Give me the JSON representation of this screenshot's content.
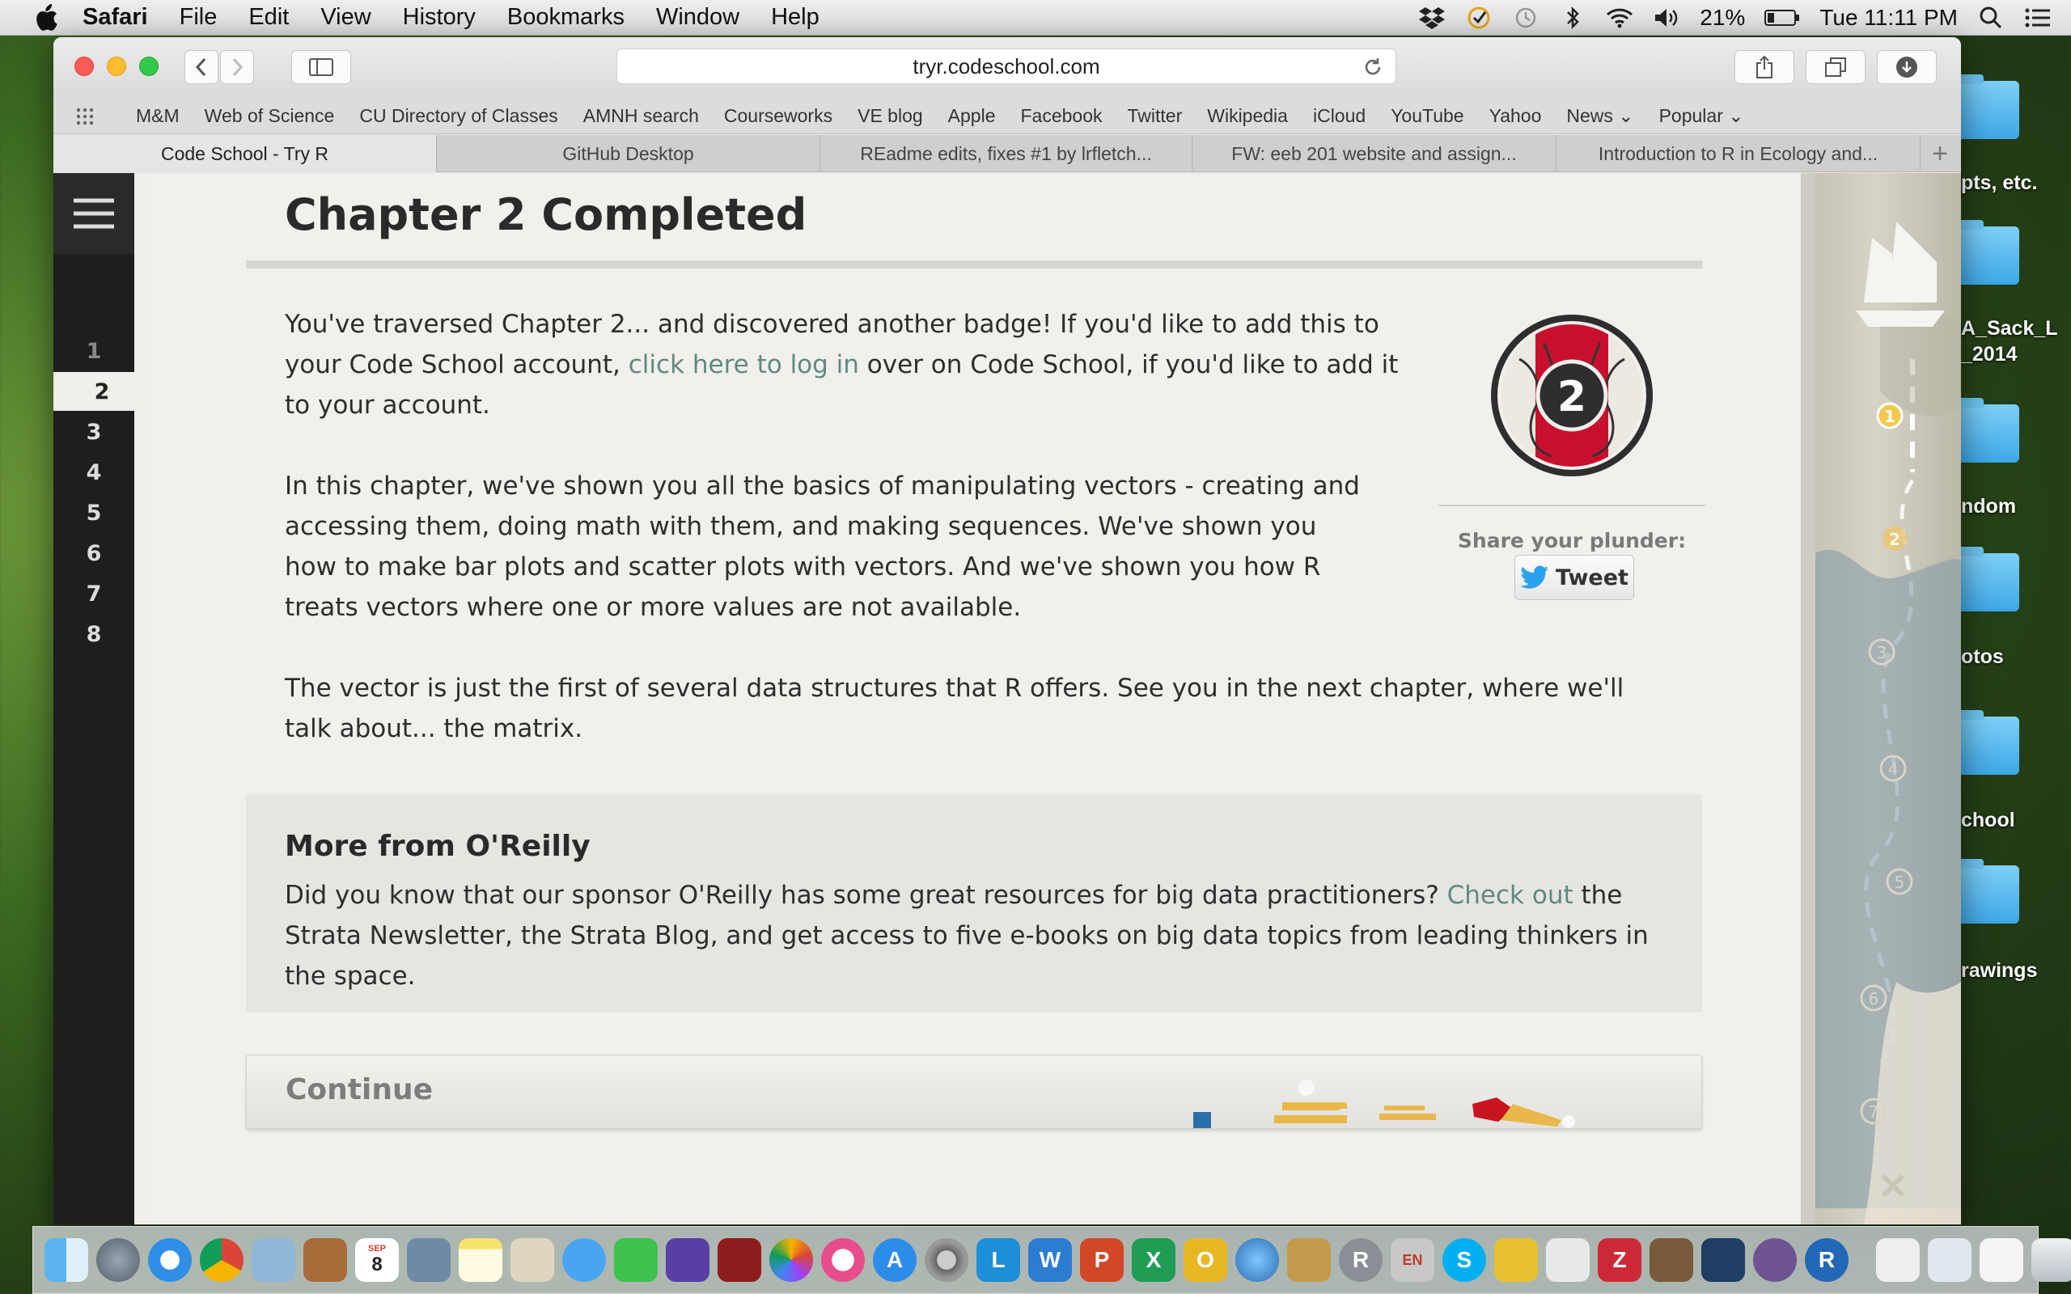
{
  "menubar": {
    "app": "Safari",
    "items": [
      "File",
      "Edit",
      "View",
      "History",
      "Bookmarks",
      "Window",
      "Help"
    ],
    "battery": "21%",
    "clock": "Tue 11:11 PM"
  },
  "browser": {
    "url": "tryr.codeschool.com",
    "favorites": [
      "M&M",
      "Web of Science",
      "CU Directory of Classes",
      "AMNH search",
      "Courseworks",
      "VE blog",
      "Apple",
      "Facebook",
      "Twitter",
      "Wikipedia",
      "iCloud",
      "YouTube",
      "Yahoo",
      "News ⌄",
      "Popular ⌄"
    ],
    "tabs": [
      {
        "title": "Code School - Try R",
        "active": true
      },
      {
        "title": "GitHub Desktop",
        "active": false
      },
      {
        "title": "REadme edits, fixes #1 by lrfletch...",
        "active": false
      },
      {
        "title": "FW: eeb 201 website and assign...",
        "active": false
      },
      {
        "title": "Introduction to R in Ecology and...",
        "active": false
      }
    ]
  },
  "nav": {
    "chapters": [
      "1",
      "2",
      "3",
      "4",
      "5",
      "6",
      "7",
      "8"
    ],
    "active_chapter": "2"
  },
  "page": {
    "title": "Chapter 2 Completed",
    "para1_start": "You've traversed Chapter 2... and discovered another badge! If you'd like to add this to your Code School account, ",
    "para1_link": "click here to log in",
    "para1_end": " over on Code School, if you'd like to add it to your account.",
    "para2": "In this chapter, we've shown you all the basics of manipulating vectors - creating and accessing them, doing math with them, and making sequences. We've shown you how to make bar plots and scatter plots with vectors. And we've shown you how R treats vectors where one or more values are not available.",
    "para3": "The vector is just the first of several data structures that R offers. See you in the next chapter, where we'll talk about... the matrix.",
    "badge_number": "2",
    "share_label": "Share your plunder:",
    "tweet_label": "Tweet",
    "oreilly_heading": "More from O'Reilly",
    "oreilly_start": "Did you know that our sponsor O'Reilly has some great resources for big data practitioners? ",
    "oreilly_link": "Check out",
    "oreilly_end": " the Strata Newsletter, the Strata Blog, and get access to five e-books on big data topics from leading thinkers in the space.",
    "continue_label": "Continue"
  },
  "map": {
    "markers": [
      "1",
      "2",
      "3",
      "4",
      "5",
      "6",
      "7"
    ]
  },
  "desktop": {
    "labels": [
      "pts, etc.",
      "A_Sack_L",
      "_2014",
      "ndom",
      "otos",
      "chool",
      "rawings"
    ]
  },
  "dock": {
    "calendar_month": "SEP",
    "calendar_day": "8"
  },
  "colors": {
    "link": "#5f8a80",
    "badge_red": "#c8102e",
    "nav_bg": "#1e1e1e",
    "map_marker": "#f2c94c"
  }
}
